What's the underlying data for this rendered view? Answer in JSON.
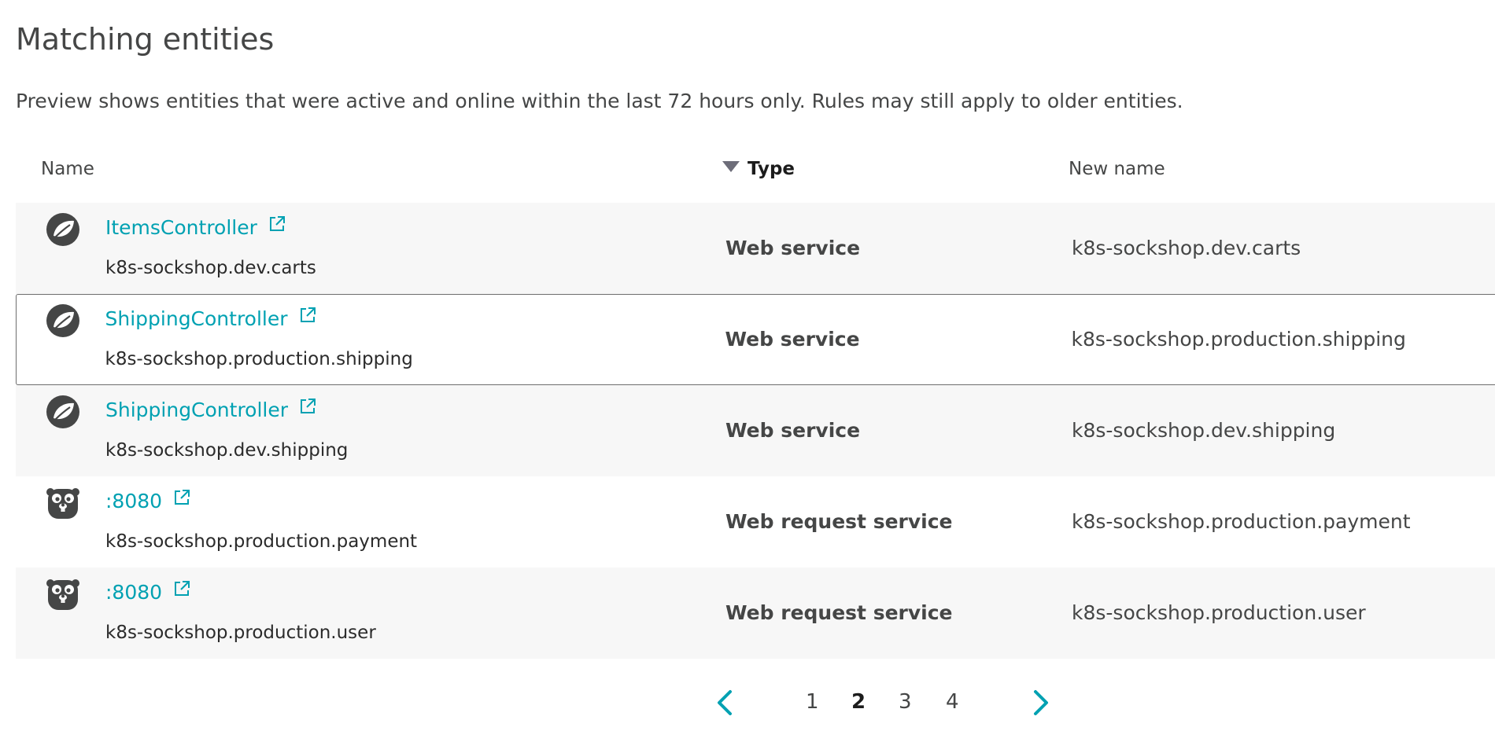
{
  "header": {
    "title": "Matching entities",
    "description": "Preview shows entities that were active and online within the last 72 hours only. Rules may still apply to older entities."
  },
  "table": {
    "columns": {
      "name": "Name",
      "type": "Type",
      "new_name": "New name"
    },
    "sort": {
      "column": "Type",
      "direction": "descending"
    },
    "rows": [
      {
        "icon": "spring-leaf-icon",
        "name": "ItemsController",
        "detail": "k8s-sockshop.dev.carts",
        "type": "Web service",
        "new_name": "k8s-sockshop.dev.carts"
      },
      {
        "icon": "spring-leaf-icon",
        "name": "ShippingController",
        "detail": "k8s-sockshop.production.shipping",
        "type": "Web service",
        "new_name": "k8s-sockshop.production.shipping"
      },
      {
        "icon": "spring-leaf-icon",
        "name": "ShippingController",
        "detail": "k8s-sockshop.dev.shipping",
        "type": "Web service",
        "new_name": "k8s-sockshop.dev.shipping"
      },
      {
        "icon": "go-gopher-icon",
        "name": ":8080",
        "detail": "k8s-sockshop.production.payment",
        "type": "Web request service",
        "new_name": "k8s-sockshop.production.payment"
      },
      {
        "icon": "go-gopher-icon",
        "name": ":8080",
        "detail": "k8s-sockshop.production.user",
        "type": "Web request service",
        "new_name": "k8s-sockshop.production.user"
      }
    ]
  },
  "pagination": {
    "pages": [
      "1",
      "2",
      "3",
      "4"
    ],
    "current": "2",
    "prev_icon": "chevron-left-icon",
    "next_icon": "chevron-right-icon"
  },
  "colors": {
    "link": "#00a1b2",
    "text": "#454646",
    "row_alt": "#f7f7f7",
    "selected_border": "#6d6d6d"
  }
}
